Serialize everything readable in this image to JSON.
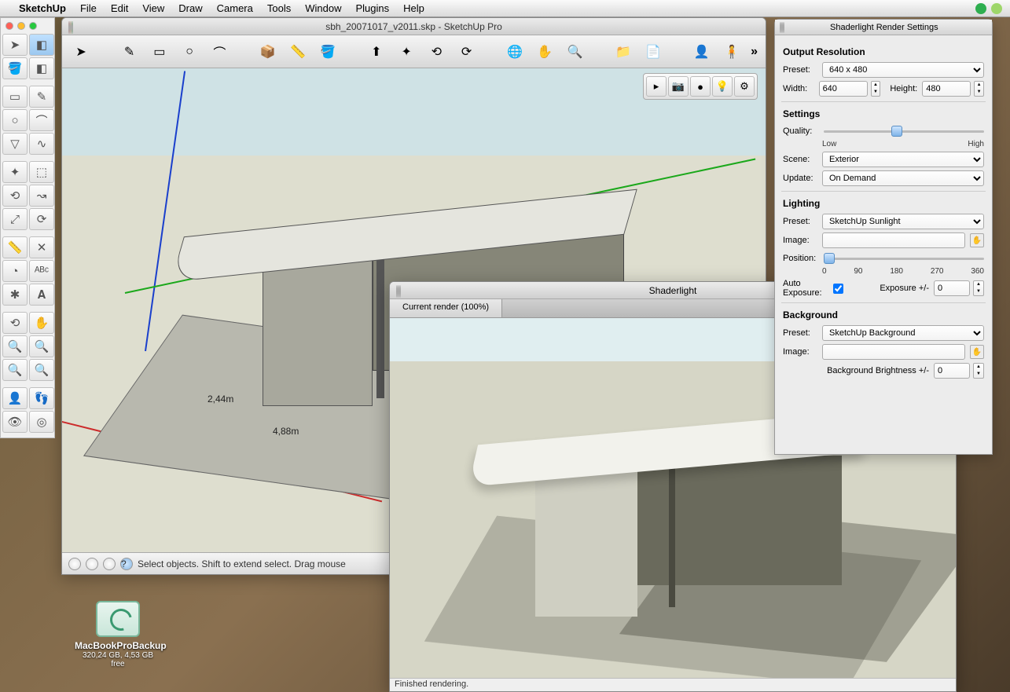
{
  "menubar": {
    "app": "SketchUp",
    "items": [
      "File",
      "Edit",
      "View",
      "Draw",
      "Camera",
      "Tools",
      "Window",
      "Plugins",
      "Help"
    ]
  },
  "mainWindow": {
    "title": "sbh_20071017_v2011.skp - SketchUp Pro",
    "statusHint": "Select objects. Shift to extend select. Drag mouse",
    "dim1": "2,44m",
    "dim2": "4,88m"
  },
  "renderWindow": {
    "title": "Shaderlight",
    "tab": "Current render (100%)",
    "status": "Finished rendering."
  },
  "settings": {
    "title": "Shaderlight Render Settings",
    "outputResolution": {
      "heading": "Output Resolution",
      "presetLabel": "Preset:",
      "preset": "640 x 480",
      "widthLabel": "Width:",
      "width": "640",
      "heightLabel": "Height:",
      "height": "480"
    },
    "general": {
      "heading": "Settings",
      "qualityLabel": "Quality:",
      "low": "Low",
      "high": "High",
      "sceneLabel": "Scene:",
      "scene": "Exterior",
      "updateLabel": "Update:",
      "update": "On Demand"
    },
    "lighting": {
      "heading": "Lighting",
      "presetLabel": "Preset:",
      "preset": "SketchUp Sunlight",
      "imageLabel": "Image:",
      "image": "",
      "positionLabel": "Position:",
      "ticks": [
        "0",
        "90",
        "180",
        "270",
        "360"
      ],
      "autoExposureLabel": "Auto Exposure:",
      "autoExposure": true,
      "exposureLabel": "Exposure +/-",
      "exposure": "0"
    },
    "background": {
      "heading": "Background",
      "presetLabel": "Preset:",
      "preset": "SketchUp Background",
      "imageLabel": "Image:",
      "image": "",
      "brightnessLabel": "Background Brightness +/-",
      "brightness": "0"
    }
  },
  "drive": {
    "name": "MacBookProBackup",
    "meta": "320,24 GB, 4,53 GB free"
  }
}
